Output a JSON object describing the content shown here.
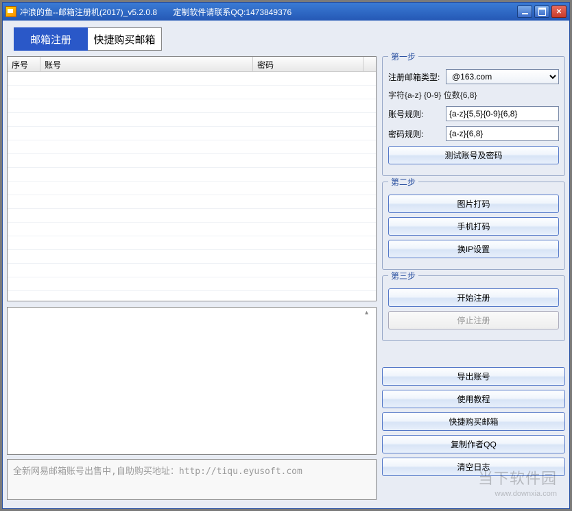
{
  "window": {
    "title": "冲浪的鱼--邮箱注册机(2017)_v5.2.0.8       定制软件请联系QQ:1473849376"
  },
  "tabs": {
    "register": "邮箱注册",
    "buy": "快捷购买邮箱"
  },
  "table": {
    "col_index": "序号",
    "col_account": "账号",
    "col_password": "密码"
  },
  "step1": {
    "title": "第一步",
    "type_label": "注册邮箱类型:",
    "type_value": "@163.com",
    "char_hint": "字符{a-z}  {0-9}   位数{6,8}",
    "account_rule_label": "账号规则:",
    "account_rule_value": "{a-z}{5,5}{0-9}{6,8}",
    "password_rule_label": "密码规则:",
    "password_rule_value": "{a-z}{6,8}",
    "test_button": "测试账号及密码"
  },
  "step2": {
    "title": "第二步",
    "btn_image_captcha": "图片打码",
    "btn_phone_captcha": "手机打码",
    "btn_ip_settings": "换IP设置"
  },
  "step3": {
    "title": "第三步",
    "btn_start": "开始注册",
    "btn_stop": "停止注册"
  },
  "actions": {
    "export": "导出账号",
    "tutorial": "使用教程",
    "quickbuy": "快捷购买邮箱",
    "copy_qq": "复制作者QQ",
    "clear_log": "清空日志"
  },
  "footer": {
    "msg": "全新网易邮箱账号出售中,自助购买地址：http://tiqu.eyusoft.com"
  },
  "watermark": {
    "brand": "当下软件园",
    "url": "www.downxia.com"
  }
}
